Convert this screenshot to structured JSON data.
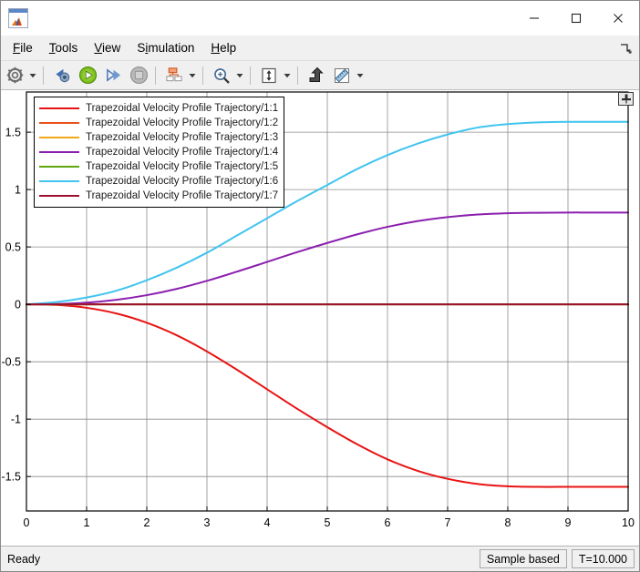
{
  "window": {
    "app_icon": "matlab-membrane-icon",
    "minimize_label": "Minimize",
    "maximize_label": "Maximize",
    "close_label": "Close"
  },
  "menubar": {
    "items": [
      {
        "label": "File",
        "mnemonic": "F"
      },
      {
        "label": "Tools",
        "mnemonic": "T"
      },
      {
        "label": "View",
        "mnemonic": "V"
      },
      {
        "label": "Simulation",
        "mnemonic": "i"
      },
      {
        "label": "Help",
        "mnemonic": "H"
      }
    ],
    "undock_icon": "undock-arrow-icon"
  },
  "toolbar": {
    "buttons": [
      {
        "name": "configuration-properties-button",
        "icon": "gear-icon",
        "has_dropdown": true
      },
      {
        "name": "run-back-to-start-button",
        "icon": "rewind-icon",
        "has_dropdown": false
      },
      {
        "name": "run-button",
        "icon": "play-icon",
        "has_dropdown": false
      },
      {
        "name": "step-forward-button",
        "icon": "step-forward-icon",
        "has_dropdown": false
      },
      {
        "name": "stop-button",
        "icon": "stop-icon",
        "has_dropdown": false
      },
      {
        "name": "layout-button",
        "icon": "layout-grid-icon",
        "has_dropdown": true
      },
      {
        "name": "zoom-button",
        "icon": "zoom-in-magnifier-icon",
        "has_dropdown": true
      },
      {
        "name": "autoscale-button",
        "icon": "autoscale-icon",
        "has_dropdown": true
      },
      {
        "name": "highlight-signal-button",
        "icon": "highlight-signal-arrow-icon",
        "has_dropdown": false
      },
      {
        "name": "measurements-button",
        "icon": "ruler-icon",
        "has_dropdown": true
      }
    ]
  },
  "plot": {
    "pin_icon": "data-cursor-pin-icon",
    "legend": {
      "entries": [
        {
          "label": "Trapezoidal Velocity Profile Trajectory/1:1",
          "color": "#e81313"
        },
        {
          "label": "Trapezoidal Velocity Profile Trajectory/1:2",
          "color": "#e8521c"
        },
        {
          "label": "Trapezoidal Velocity Profile Trajectory/1:3",
          "color": "#f0a818"
        },
        {
          "label": "Trapezoidal Velocity Profile Trajectory/1:4",
          "color": "#8b1fae"
        },
        {
          "label": "Trapezoidal Velocity Profile Trajectory/1:5",
          "color": "#61a712"
        },
        {
          "label": "Trapezoidal Velocity Profile Trajectory/1:6",
          "color": "#41c4ef"
        },
        {
          "label": "Trapezoidal Velocity Profile Trajectory/1:7",
          "color": "#9e1032"
        }
      ]
    }
  },
  "chart_data": {
    "type": "line",
    "title": "",
    "xlabel": "",
    "ylabel": "",
    "xlim": [
      0,
      10
    ],
    "ylim": [
      -1.8,
      1.85
    ],
    "xticks": [
      0,
      1,
      2,
      3,
      4,
      5,
      6,
      7,
      8,
      9,
      10
    ],
    "xticklabels": [
      "0",
      "1",
      "2",
      "3",
      "4",
      "5",
      "6",
      "7",
      "8",
      "9",
      "10"
    ],
    "yticks": [
      1.5,
      1,
      0.5,
      0,
      -0.5,
      -1,
      -1.5
    ],
    "yticklabels": [
      "1.5",
      "1",
      "0.5",
      "0",
      "-0.5",
      "-1",
      "-1.5"
    ],
    "grid": true,
    "legend_position": "top-left",
    "x": [
      0,
      0.5,
      1,
      1.5,
      2,
      2.5,
      3,
      3.5,
      4,
      4.5,
      5,
      5.5,
      6,
      6.5,
      7,
      7.5,
      8,
      8.5,
      9,
      9.5,
      10
    ],
    "series": [
      {
        "name": "Trapezoidal Velocity Profile Trajectory/1:1",
        "color": "#e81313",
        "values": [
          0,
          -0.005,
          -0.03,
          -0.08,
          -0.16,
          -0.27,
          -0.41,
          -0.57,
          -0.74,
          -0.91,
          -1.07,
          -1.22,
          -1.35,
          -1.45,
          -1.52,
          -1.565,
          -1.585,
          -1.59,
          -1.59,
          -1.59,
          -1.59
        ]
      },
      {
        "name": "Trapezoidal Velocity Profile Trajectory/1:2",
        "color": "#e8521c",
        "values": [
          0,
          0,
          0,
          0,
          0,
          0,
          0,
          0,
          0,
          0,
          0,
          0,
          0,
          0,
          0,
          0,
          0,
          0,
          0,
          0,
          0
        ]
      },
      {
        "name": "Trapezoidal Velocity Profile Trajectory/1:3",
        "color": "#f0a818",
        "values": [
          0,
          0,
          0,
          0,
          0,
          0,
          0,
          0,
          0,
          0,
          0,
          0,
          0,
          0,
          0,
          0,
          0,
          0,
          0,
          0,
          0
        ]
      },
      {
        "name": "Trapezoidal Velocity Profile Trajectory/1:4",
        "color": "#8b1fae",
        "values": [
          0,
          0.003,
          0.015,
          0.04,
          0.08,
          0.135,
          0.205,
          0.285,
          0.37,
          0.455,
          0.535,
          0.61,
          0.675,
          0.725,
          0.76,
          0.783,
          0.794,
          0.798,
          0.8,
          0.8,
          0.8
        ]
      },
      {
        "name": "Trapezoidal Velocity Profile Trajectory/1:5",
        "color": "#61a712",
        "values": [
          0,
          0,
          0,
          0,
          0,
          0,
          0,
          0,
          0,
          0,
          0,
          0,
          0,
          0,
          0,
          0,
          0,
          0,
          0,
          0,
          0
        ]
      },
      {
        "name": "Trapezoidal Velocity Profile Trajectory/1:6",
        "color": "#41c4ef",
        "values": [
          0,
          0.02,
          0.06,
          0.12,
          0.21,
          0.32,
          0.45,
          0.6,
          0.75,
          0.9,
          1.04,
          1.18,
          1.3,
          1.4,
          1.48,
          1.54,
          1.57,
          1.585,
          1.59,
          1.59,
          1.59
        ]
      },
      {
        "name": "Trapezoidal Velocity Profile Trajectory/1:7",
        "color": "#9e1032",
        "values": [
          0,
          0,
          0,
          0,
          0,
          0,
          0,
          0,
          0,
          0,
          0,
          0,
          0,
          0,
          0,
          0,
          0,
          0,
          0,
          0,
          0
        ]
      }
    ]
  },
  "statusbar": {
    "message": "Ready",
    "frame_mode": "Sample based",
    "time": "T=10.000"
  }
}
